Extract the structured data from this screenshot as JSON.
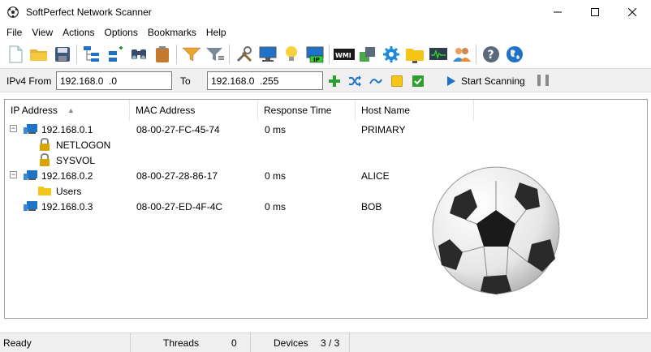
{
  "window": {
    "title": "SoftPerfect Network Scanner"
  },
  "menu": [
    "File",
    "View",
    "Actions",
    "Options",
    "Bookmarks",
    "Help"
  ],
  "toolbar_icons": [
    "new-icon",
    "open-folder-icon",
    "save-icon",
    "expand-all-icon",
    "collapse-all-icon",
    "find-icon",
    "clipboard-icon",
    "filter-icon",
    "filter-options-icon",
    "tools-icon",
    "remote-computer-icon",
    "lightbulb-icon",
    "ip-icon",
    "wmi-icon",
    "shutdown-icon",
    "settings-gear-icon",
    "folder-icon",
    "monitor-icon",
    "users-icon",
    "help-icon",
    "web-icon"
  ],
  "range": {
    "from_label": "IPv4 From",
    "from_value": "192.168.0  .0",
    "to_label": "To",
    "to_value": "192.168.0  .255",
    "start_label": "Start Scanning"
  },
  "table": {
    "columns": [
      "IP Address",
      "MAC Address",
      "Response Time",
      "Host Name"
    ],
    "sorted_column": "IP Address",
    "hosts": [
      {
        "ip": "192.168.0.1",
        "mac": "08-00-27-FC-45-74",
        "time": "0 ms",
        "name": "PRIMARY",
        "expanded": true,
        "shares": [
          {
            "name": "NETLOGON",
            "type": "locked"
          },
          {
            "name": "SYSVOL",
            "type": "locked"
          }
        ]
      },
      {
        "ip": "192.168.0.2",
        "mac": "08-00-27-28-86-17",
        "time": "0 ms",
        "name": "ALICE",
        "expanded": true,
        "shares": [
          {
            "name": "Users",
            "type": "folder"
          }
        ]
      },
      {
        "ip": "192.168.0.3",
        "mac": "08-00-27-ED-4F-4C",
        "time": "0 ms",
        "name": "BOB",
        "expanded": false,
        "shares": []
      }
    ]
  },
  "status": {
    "state": "Ready",
    "threads_label": "Threads",
    "threads_value": "0",
    "devices_label": "Devices",
    "devices_value": "3 / 3"
  },
  "colors": {
    "accent": "#1e73c8",
    "green": "#2e9e2e",
    "folder": "#f5c518",
    "lock": "#d9a400"
  }
}
